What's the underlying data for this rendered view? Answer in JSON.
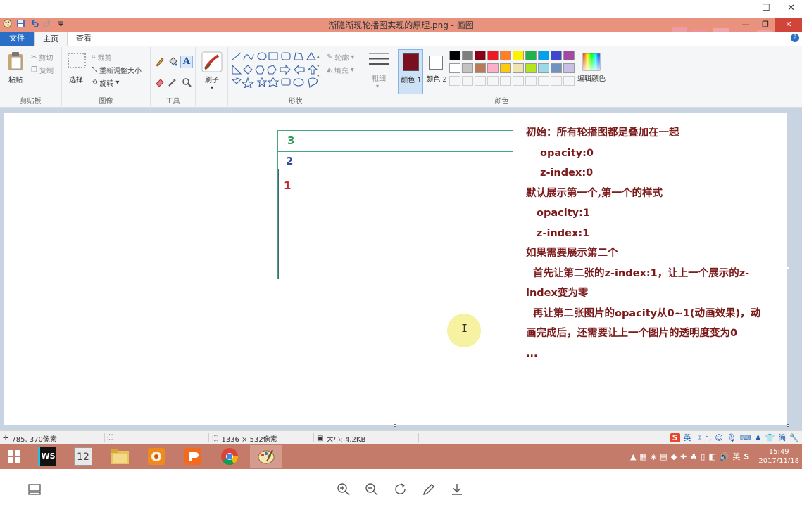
{
  "window": {
    "title": "渐隐渐现轮播图实现的原理.png - 画图",
    "minimize": "—",
    "maximize": "☐",
    "restore": "❐",
    "close": "✕"
  },
  "outer_window": {
    "minimize": "—",
    "maximize": "☐",
    "close": "✕"
  },
  "ribbon_tabs": [
    {
      "label": "文件"
    },
    {
      "label": "主页"
    },
    {
      "label": "查看"
    }
  ],
  "help_label": "?",
  "ribbon": {
    "clipboard": {
      "paste": "粘贴",
      "cut": "剪切",
      "copy": "复制",
      "label": "剪贴板"
    },
    "image": {
      "select": "选择",
      "crop": "裁剪",
      "resize": "重新调整大小",
      "rotate": "旋转",
      "label": "图像"
    },
    "tools": {
      "label": "工具"
    },
    "brush": {
      "label": "刷子"
    },
    "shapes": {
      "outline": "轮廓",
      "fill": "填充",
      "label": "形状"
    },
    "size": {
      "label": "粗细"
    },
    "colors": {
      "color1_label": "颜色 1",
      "color2_label": "颜色 2",
      "edit_label": "编辑颜色",
      "group_label": "颜色",
      "color1": "#7a0f1f",
      "color2": "#ffffff",
      "palette_row1": [
        "#000000",
        "#7f7f7f",
        "#880015",
        "#ed1c24",
        "#ff7f27",
        "#fff200",
        "#22b14c",
        "#00a2e8",
        "#3f48cc",
        "#a349a4"
      ],
      "palette_row2": [
        "#ffffff",
        "#c3c3c3",
        "#b97a57",
        "#ffaec9",
        "#ffc90e",
        "#efe4b0",
        "#b5e61d",
        "#99d9ea",
        "#7092be",
        "#c8bfe7"
      ]
    }
  },
  "canvas": {
    "boxes": [
      {
        "label": "3",
        "color": "#2e9b5b"
      },
      {
        "label": "2",
        "color": "#3a4a9a"
      },
      {
        "label": "1",
        "color": "#c62828"
      }
    ],
    "notes": [
      "初始：所有轮播图都是叠加在一起",
      "    opacity:0",
      "    z-index:0",
      "默认展示第一个,第一个的样式",
      "   opacity:1",
      "   z-index:1",
      "如果需要展示第二个",
      "  首先让第二张的z-index:1，让上一个展示的z-",
      "index变为零",
      "  再让第二张图片的opacity从0~1(动画效果)，动",
      "画完成后，还需要让上一个图片的透明度变为0",
      "..."
    ]
  },
  "statusbar": {
    "cursor_pos": "785, 370像素",
    "image_size": "1336 × 532像素",
    "file_size": "大小: 4.2KB"
  },
  "ime": {
    "brand": "S",
    "lang": "英",
    "simplified": "简"
  },
  "taskbar": {
    "apps": [
      {
        "name": "webstorm",
        "label": "WS"
      },
      {
        "name": "app-12",
        "label": "12"
      },
      {
        "name": "file-explorer",
        "label": ""
      },
      {
        "name": "orange-app",
        "label": ""
      },
      {
        "name": "presentation",
        "label": ""
      },
      {
        "name": "chrome",
        "label": ""
      },
      {
        "name": "paint",
        "label": ""
      }
    ],
    "lang": "英",
    "time": "15:49",
    "date": "2017/11/18"
  }
}
